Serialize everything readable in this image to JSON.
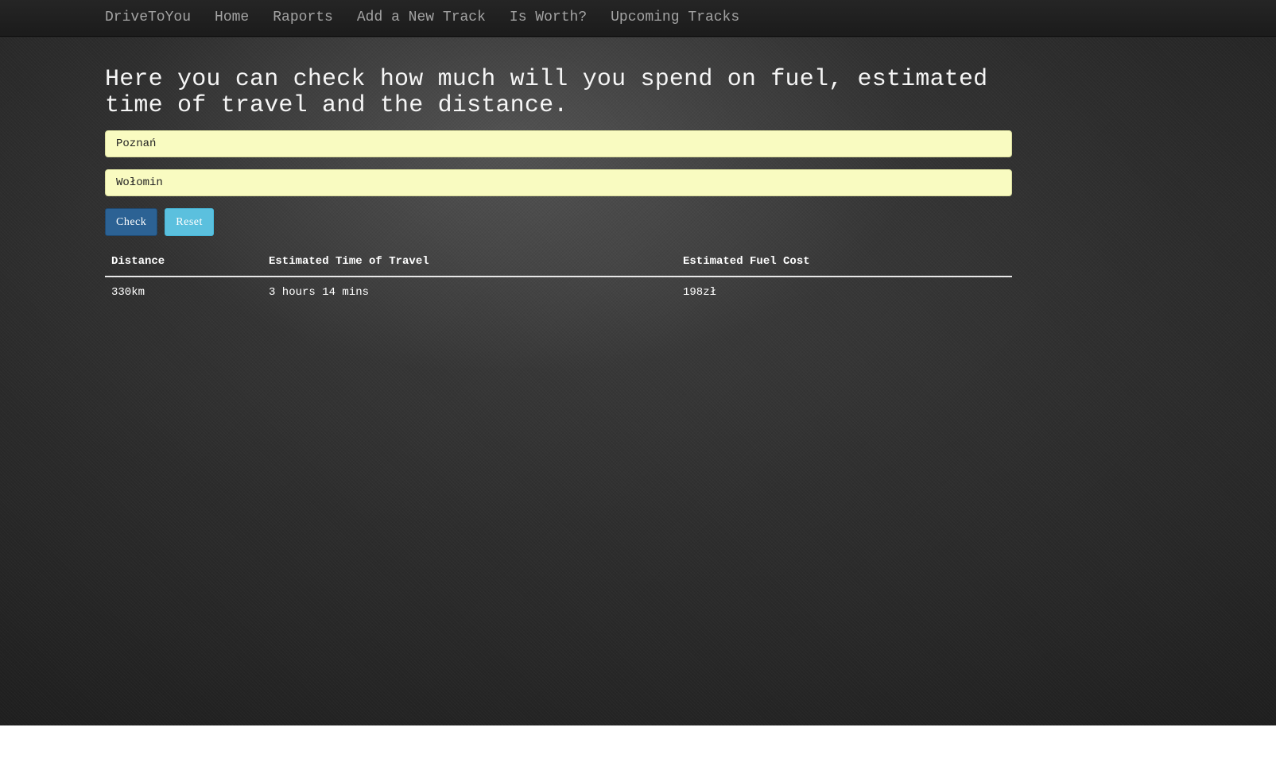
{
  "nav": {
    "brand": "DriveToYou",
    "links": [
      "Home",
      "Raports",
      "Add a New Track",
      "Is Worth?",
      "Upcoming Tracks"
    ]
  },
  "main": {
    "heading": "Here you can check how much will you spend on fuel, estimated time of travel and the distance.",
    "origin_value": "Poznań",
    "destination_value": "Wołomin",
    "check_label": "Check",
    "reset_label": "Reset"
  },
  "results": {
    "headers": [
      "Distance",
      "Estimated Time of Travel",
      "Estimated Fuel Cost"
    ],
    "rows": [
      [
        "330km",
        "3 hours 14 mins",
        "198zł"
      ]
    ]
  },
  "colors": {
    "input_background": "#f9fbc1",
    "check_button": "#2c6294",
    "reset_button": "#5bc0de"
  }
}
